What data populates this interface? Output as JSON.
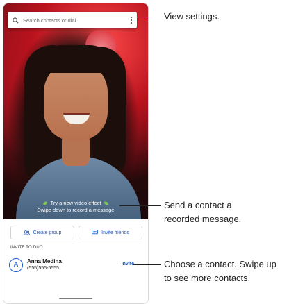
{
  "search": {
    "placeholder": "Search contacts or dial",
    "icon": "search-icon",
    "menu_icon": "more-vert-icon"
  },
  "video_effect": {
    "line1": "Try a new video effect",
    "line2": "Swipe down to record a message"
  },
  "actions": {
    "create_group": "Create group",
    "invite_friends": "Invite friends"
  },
  "invite_section": {
    "label": "INVITE TO DUO",
    "contact": {
      "initial": "A",
      "name": "Anna Medina",
      "phone": "(555)555-5555",
      "action": "Invite"
    }
  },
  "callouts": {
    "settings": "View settings.",
    "message_line1": "Send a contact a",
    "message_line2": "recorded message.",
    "contact_line1": "Choose a contact. Swipe up",
    "contact_line2": "to see more contacts."
  },
  "colors": {
    "accent": "#1a5ccf",
    "text": "#222222"
  }
}
